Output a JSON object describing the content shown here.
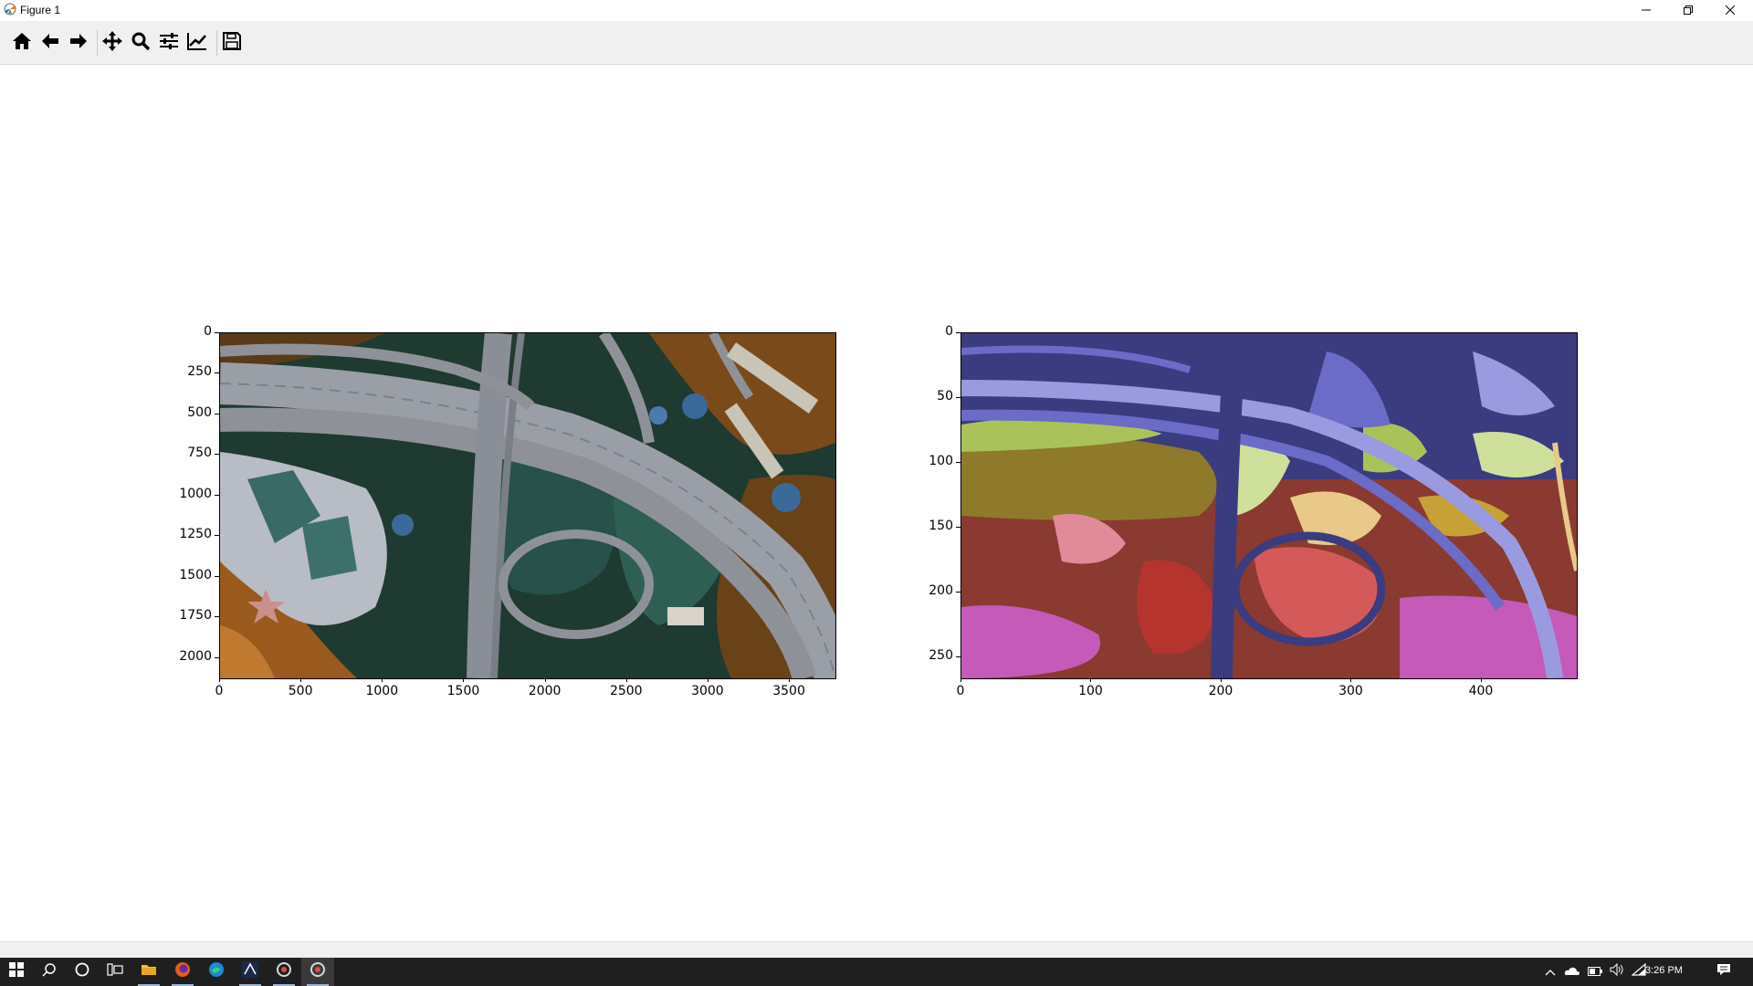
{
  "window": {
    "title": "Figure 1",
    "icons": {
      "app": "matplotlib-icon",
      "minimize": "minimize-icon",
      "restore": "restore-icon",
      "close": "close-icon"
    }
  },
  "toolbar": {
    "buttons": [
      {
        "name": "home-button",
        "icon": "home-icon"
      },
      {
        "name": "back-button",
        "icon": "arrow-left-icon"
      },
      {
        "name": "forward-button",
        "icon": "arrow-right-icon"
      },
      {
        "name": "pan-button",
        "icon": "move-icon"
      },
      {
        "name": "zoom-button",
        "icon": "magnifier-icon"
      },
      {
        "name": "subplots-button",
        "icon": "sliders-icon"
      },
      {
        "name": "edit-axes-button",
        "icon": "line-chart-icon"
      },
      {
        "name": "save-button",
        "icon": "floppy-disk-icon"
      }
    ]
  },
  "figure": {
    "left_axes": {
      "content": "aerial photo of highway interchange",
      "xticks": [
        "0",
        "500",
        "1000",
        "1500",
        "2000",
        "2500",
        "3000",
        "3500"
      ],
      "yticks": [
        "0",
        "250",
        "500",
        "750",
        "1000",
        "1250",
        "1500",
        "1750",
        "2000"
      ]
    },
    "right_axes": {
      "content": "color-clustered segmentation image",
      "xticks": [
        "0",
        "100",
        "200",
        "300",
        "400"
      ],
      "yticks": [
        "0",
        "50",
        "100",
        "150",
        "200",
        "250"
      ],
      "colors": [
        "#3b3b80",
        "#6b6bc8",
        "#9a9ae0",
        "#8e7a2a",
        "#a9c25a",
        "#cfe09a",
        "#e8c98a",
        "#b5342e",
        "#d45a5a",
        "#c55ab8",
        "#e08a9a",
        "#c7a036"
      ]
    }
  },
  "taskbar": {
    "items": [
      "start-icon",
      "search-icon",
      "cortana-icon",
      "task-view-icon",
      "file-explorer-icon",
      "firefox-icon",
      "edge-icon",
      "terminal-icon",
      "python-icon",
      "python-figure-icon"
    ],
    "tray_icons": [
      "chevron-up-icon",
      "onedrive-icon",
      "battery-icon",
      "volume-icon",
      "wifi-icon"
    ],
    "clock": "3:26 PM",
    "notification_icon": "notification-icon"
  }
}
